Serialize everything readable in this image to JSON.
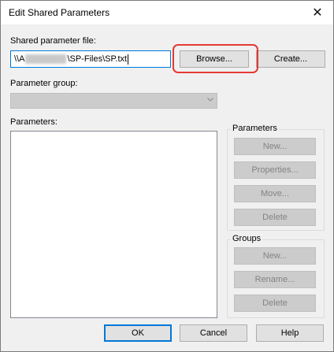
{
  "window": {
    "title": "Edit Shared Parameters",
    "close_symbol": "✕"
  },
  "shared_file": {
    "label": "Shared parameter file:",
    "value_prefix": "\\\\A",
    "value_suffix": "\\SP-Files\\SP.txt",
    "browse_label": "Browse...",
    "create_label": "Create..."
  },
  "parameter_group": {
    "label": "Parameter group:",
    "selected": ""
  },
  "parameters_list": {
    "label": "Parameters:"
  },
  "parameters_box": {
    "legend": "Parameters",
    "new_label": "New...",
    "properties_label": "Properties...",
    "move_label": "Move...",
    "delete_label": "Delete"
  },
  "groups_box": {
    "legend": "Groups",
    "new_label": "New...",
    "rename_label": "Rename...",
    "delete_label": "Delete"
  },
  "footer": {
    "ok_label": "OK",
    "cancel_label": "Cancel",
    "help_label": "Help"
  },
  "colors": {
    "highlight": "#e53935",
    "focus": "#0078d7"
  }
}
